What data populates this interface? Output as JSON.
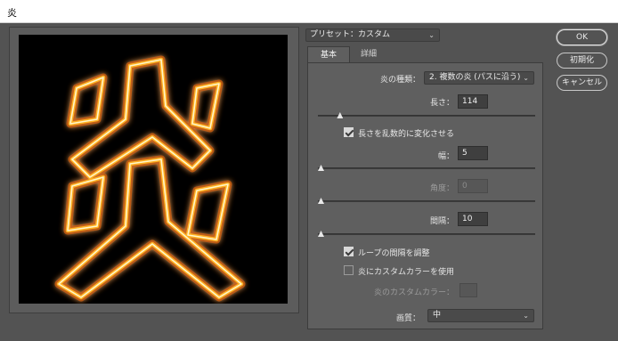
{
  "window": {
    "title": "炎"
  },
  "preset": {
    "value": "プリセット：カスタム"
  },
  "tabs": [
    {
      "label": "基本"
    },
    {
      "label": "詳細"
    }
  ],
  "fields": {
    "flame_type": {
      "label": "炎の種類：",
      "value": "2. 複数の炎 (パスに沿う)"
    },
    "length": {
      "label": "長さ：",
      "value": "114",
      "slider": 0.09
    },
    "randomize_length": {
      "label": "長さを乱数的に変化させる",
      "checked": true
    },
    "width": {
      "label": "幅：",
      "value": "5",
      "slider": 0.0
    },
    "angle": {
      "label": "角度：",
      "value": "0",
      "slider": 0.0,
      "disabled": true
    },
    "interval": {
      "label": "間隔：",
      "value": "10",
      "slider": 0.0
    },
    "adjust_loop": {
      "label": "ループの間隔を調整",
      "checked": true
    },
    "custom_color": {
      "label": "炎にカスタムカラーを使用",
      "checked": false
    },
    "custom_color_swatch": {
      "label": "炎のカスタムカラー：",
      "disabled": true
    },
    "quality": {
      "label": "画質：",
      "value": "中"
    }
  },
  "buttons": {
    "ok": "OK",
    "reset": "初期化",
    "cancel": "キャンセル"
  },
  "colors": {
    "flame_core": "#fff6c9",
    "flame_glow": "#ffb020",
    "flame_outer": "#c75a00"
  }
}
